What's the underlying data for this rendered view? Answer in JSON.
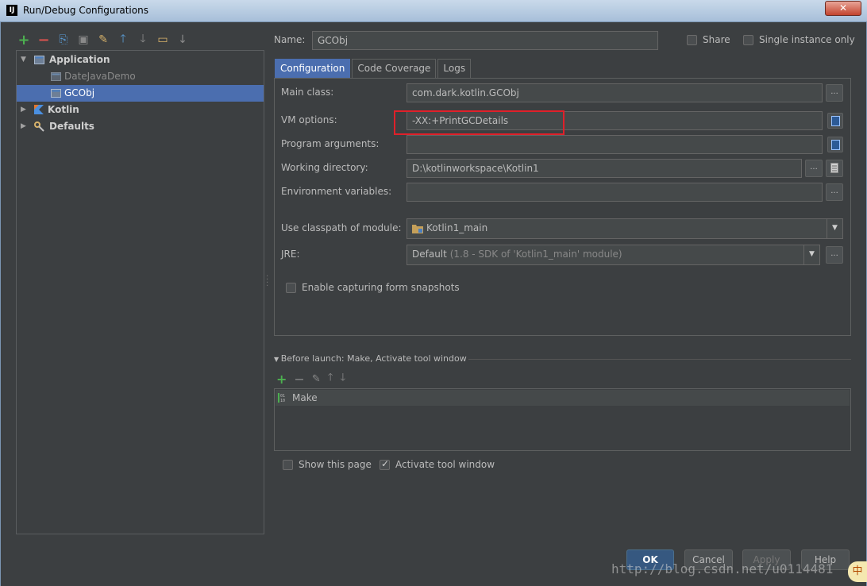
{
  "window": {
    "title": "Run/Debug Configurations",
    "app_icon": "IJ",
    "close_label": "✕"
  },
  "left_toolbar": [
    {
      "name": "add-icon",
      "glyph": "+"
    },
    {
      "name": "remove-icon",
      "glyph": "−"
    },
    {
      "name": "copy-icon",
      "glyph": "⎘"
    },
    {
      "name": "save-icon",
      "glyph": "▣"
    },
    {
      "name": "wrench-icon",
      "glyph": "✎"
    },
    {
      "name": "move-up-icon",
      "glyph": "🡑"
    },
    {
      "name": "move-down-icon",
      "glyph": "🡓"
    },
    {
      "name": "folder-icon",
      "glyph": "▭"
    },
    {
      "name": "sort-icon",
      "glyph": "↓"
    }
  ],
  "tree": {
    "application": "Application",
    "date_java_demo": "DateJavaDemo",
    "gcobj": "GCObj",
    "kotlin": "Kotlin",
    "defaults": "Defaults"
  },
  "header": {
    "name_label": "Name:",
    "name_value": "GCObj",
    "share_label": "Share",
    "single_instance_label": "Single instance only"
  },
  "tabs": [
    "Configuration",
    "Code Coverage",
    "Logs"
  ],
  "config": {
    "main_class_label": "Main class:",
    "main_class_value": "com.dark.kotlin.GCObj",
    "vm_options_label": "VM options:",
    "vm_options_value": "-XX:+PrintGCDetails",
    "program_arguments_label": "Program arguments:",
    "program_arguments_value": "",
    "working_directory_label": "Working directory:",
    "working_directory_value": "D:\\kotlinworkspace\\Kotlin1",
    "environment_variables_label": "Environment variables:",
    "environment_variables_value": "",
    "classpath_label": "Use classpath of module:",
    "classpath_value": "Kotlin1_main",
    "jre_label": "JRE:",
    "jre_value": "Default",
    "jre_hint": "(1.8 - SDK of 'Kotlin1_main' module)",
    "snapshots_label": "Enable capturing form snapshots",
    "ellipsis": "..."
  },
  "before_launch": {
    "title": "Before launch: Make, Activate tool window",
    "item": "Make",
    "show_page_label": "Show this page",
    "activate_label": "Activate tool window"
  },
  "buttons": {
    "ok": "OK",
    "cancel": "Cancel",
    "apply": "Apply",
    "help": "Help"
  },
  "watermark": "http://blog.csdn.net/u0114481",
  "ime_indicator": "中"
}
